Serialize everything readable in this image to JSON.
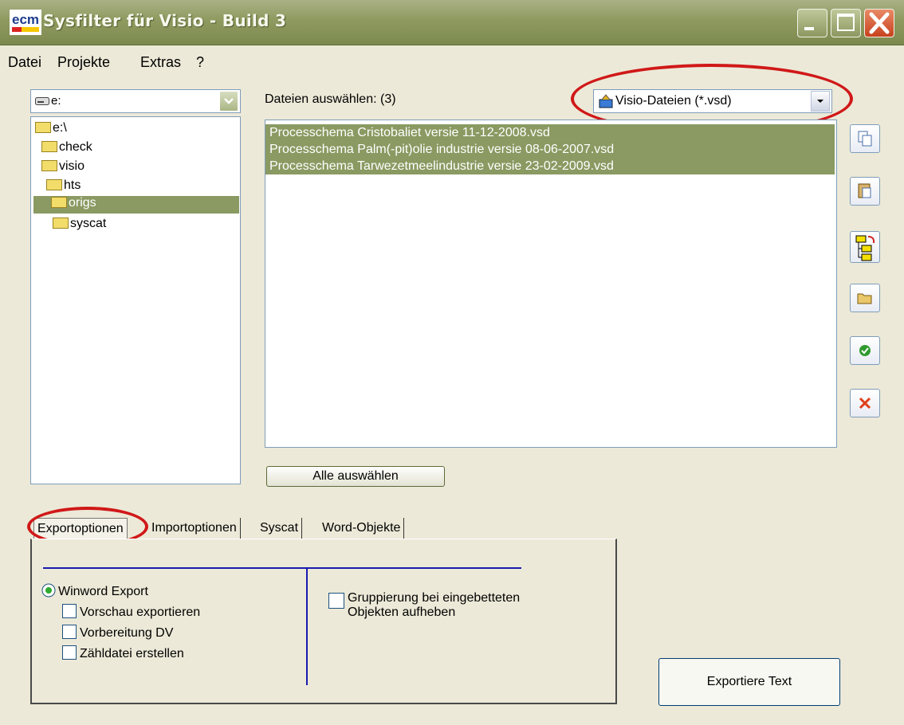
{
  "window": {
    "title": "Sysfilter für Visio - Build 3",
    "logo_text": "ecm"
  },
  "menu": [
    "Datei",
    "Projekte",
    "Extras",
    "?"
  ],
  "drive": {
    "value": "e:"
  },
  "tree": {
    "items": [
      "e:\\",
      "check",
      "visio",
      "hts",
      "origs",
      "syscat"
    ],
    "selected": "origs"
  },
  "files": {
    "label": "Dateien auswählen: (3)",
    "filter": "Visio-Dateien (*.vsd)",
    "items": [
      "Processchema Cristobaliet versie 11-12-2008.vsd",
      "Processchema Palm(-pit)olie industrie versie 08-06-2007.vsd",
      "Processchema Tarwezetmeelindustrie versie 23-02-2009.vsd"
    ],
    "select_all": "Alle auswählen"
  },
  "side_buttons": [
    "copy-icon",
    "paste-icon",
    "tree-refresh-icon",
    "open-folder-icon",
    "ok-icon",
    "cancel-icon"
  ],
  "tabs": [
    "Exportoptionen",
    "Importoptionen",
    "Syscat",
    "Word-Objekte"
  ],
  "export_options": {
    "radio_label": "Winword Export",
    "checkboxes": [
      "Vorschau exportieren",
      "Vorbereitung DV",
      "Zähldatei erstellen"
    ],
    "group_label_line1": "Gruppierung bei eingebetteten",
    "group_label_line2": "Objekten aufheben"
  },
  "export_button": "Exportiere Text",
  "colors": {
    "titlebar": "#8e9a5f",
    "selection": "#8a9a62",
    "annotation": "#d01818",
    "divider": "#1a1ab0"
  }
}
